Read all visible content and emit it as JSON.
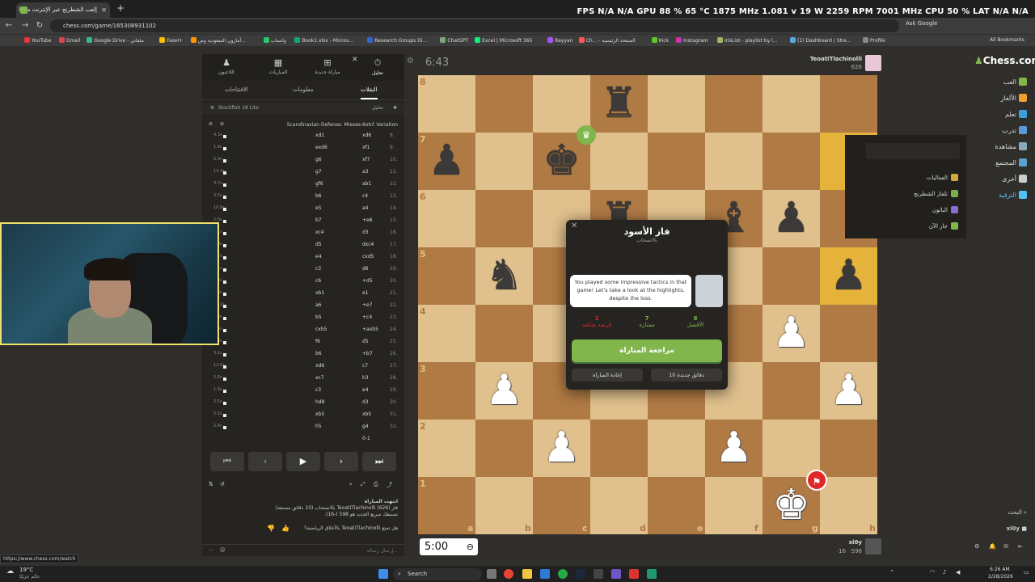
{
  "browser": {
    "tab_title": "إلعب الشطرنج عبر الإنترنت مجانًا",
    "url": "chess.com/game/165308931102",
    "ask_google": "Ask Google",
    "all_bookmarks": "All Bookmarks",
    "bookmarks": [
      "YouTube",
      "Gmail",
      "Google Drive - ملفاتي",
      "Fasel+",
      "أمازون السعودية وص...",
      "واتساب",
      "Book1.xlsx - Micros...",
      "Research Groups Di...",
      "ChatGPT",
      "Excel | Microsoft 365",
      "Rayyan",
      "Ch... - الصفحة الرئيسية",
      "Kick",
      "Instagram",
      "IrisList - playlist by l...",
      "(1) Dashboard / Stre...",
      "Profile"
    ]
  },
  "hud": "FPS  N/A  N/A    GPU  88 %  65 °C  1875 MHz  1.081 v  19 W  2259 RPM  7001 MHz    CPU  50 %    LAT  N/A  N/A",
  "panel": {
    "tabs": [
      "تحليل",
      "مباراة جديدة",
      "المباريات",
      "اللاعبون"
    ],
    "subtabs": [
      "النقلات",
      "معلومات",
      "الافتتاحات"
    ],
    "engine": "Stockfish 18 Lite",
    "analysis_label": "تحليل",
    "opening": "Scandinavian Defense: Mieses-Kotrč Variation",
    "moves": [
      {
        "n": "8.",
        "w": "xd6",
        "b": "xd1",
        "t": "4.3s"
      },
      {
        "n": "9.",
        "w": "xf1",
        "b": "exd6",
        "t": "1.8s"
      },
      {
        "n": "10.",
        "w": "xf7",
        "b": "g6",
        "t": "5.9s"
      },
      {
        "n": "11.",
        "w": "a3",
        "b": "g7",
        "t": "13.4s"
      },
      {
        "n": "12.",
        "w": "ab1",
        "b": "gf6",
        "t": "3.7s"
      },
      {
        "n": "13.",
        "w": "c4",
        "b": "b6",
        "t": "3.5s"
      },
      {
        "n": "14.",
        "w": "a4",
        "b": "e5",
        "t": "10.6s"
      },
      {
        "n": "15.",
        "w": "+e6",
        "b": "b7",
        "t": "2.0s"
      },
      {
        "n": "16.",
        "w": "d3",
        "b": "xc4",
        "t": "1.1s"
      },
      {
        "n": "17.",
        "w": "dxc4",
        "b": "d5",
        "t": "3.0s"
      },
      {
        "n": "18.",
        "w": "cxd5",
        "b": "e4",
        "t": "1.7s"
      },
      {
        "n": "19.",
        "w": "d6",
        "b": "c3",
        "t": "2.1s"
      },
      {
        "n": "20.",
        "w": "+d5",
        "b": "c6",
        "t": "7.6s"
      },
      {
        "n": "21.",
        "w": "e1",
        "b": "xb1",
        "t": "2.0s"
      },
      {
        "n": "22.",
        "w": "+e7",
        "b": "a6",
        "t": "11.2s"
      },
      {
        "n": "23.",
        "w": "+c4",
        "b": "b5",
        "t": "3.0s"
      },
      {
        "n": "24.",
        "w": "+axb5",
        "b": "cxb5",
        "t": "2.6s"
      },
      {
        "n": "25.",
        "w": "d5",
        "b": "f6",
        "t": "6.0s"
      },
      {
        "n": "26.",
        "w": "+b7",
        "b": "b6",
        "t": "3.2s"
      },
      {
        "n": "27.",
        "w": "c7",
        "b": "xd6",
        "t": "12.5s"
      },
      {
        "n": "28.",
        "w": "h3",
        "b": "xc7",
        "t": "5.6s"
      },
      {
        "n": "29.",
        "w": "e4",
        "b": "c3",
        "t": "1.0s"
      },
      {
        "n": "30.",
        "w": "d3",
        "b": "hd8",
        "t": "2.5s"
      },
      {
        "n": "31.",
        "w": "xb5",
        "b": "xb5",
        "t": "5.5s"
      },
      {
        "n": "32.",
        "w": "g4",
        "b": "h5",
        "t": "2.4s"
      },
      {
        "n": "",
        "w": "0-1",
        "b": "",
        "t": ""
      }
    ],
    "controls": [
      "⏮",
      "‹",
      "▶",
      "›",
      "⏭"
    ],
    "chat": [
      "انتهت المباراة",
      "فاز TeoatiTlachinolli (626) بالانسحاب (10 دقائق مصنفة)",
      "تصنيفك سريع الجديد هو 598 (-16).",
      "هل تمتع TeoatiTlachinolli بالأخلاق الرياضية؟"
    ],
    "chat_placeholder": "إرسال رسالة..."
  },
  "game": {
    "top_timer": "6:43",
    "top_player": "TeoatiTlachinolli",
    "top_rating": "626",
    "bottom_clock": "5:00",
    "bottom_player": "xi0y",
    "bottom_rating": "598",
    "bottom_delta": "-16"
  },
  "board": {
    "files": [
      "a",
      "b",
      "c",
      "d",
      "e",
      "f",
      "g",
      "h"
    ],
    "ranks": [
      "8",
      "7",
      "6",
      "5",
      "4",
      "3",
      "2",
      "1"
    ],
    "pieces": [
      {
        "sq": "d8",
        "p": "♜",
        "c": "b"
      },
      {
        "sq": "a7",
        "p": "♟",
        "c": "b"
      },
      {
        "sq": "c7",
        "p": "♚",
        "c": "b"
      },
      {
        "sq": "d6",
        "p": "♜",
        "c": "b"
      },
      {
        "sq": "f6",
        "p": "♝",
        "c": "b"
      },
      {
        "sq": "g6",
        "p": "♟",
        "c": "b"
      },
      {
        "sq": "b5",
        "p": "♞",
        "c": "b"
      },
      {
        "sq": "h5",
        "p": "♟",
        "c": "b"
      },
      {
        "sq": "g4",
        "p": "♟",
        "c": "w"
      },
      {
        "sq": "b3",
        "p": "♟",
        "c": "w"
      },
      {
        "sq": "h3",
        "p": "♟",
        "c": "w"
      },
      {
        "sq": "c2",
        "p": "♟",
        "c": "w"
      },
      {
        "sq": "f2",
        "p": "♟",
        "c": "w"
      },
      {
        "sq": "g1",
        "p": "♚",
        "c": "w"
      }
    ],
    "highlights": [
      "h7",
      "h5"
    ]
  },
  "modal": {
    "title": "فاز الأسود",
    "subtitle": "بالانسحاب",
    "message": "You played some impressive tactics in that game! Let's take a look at the highlights, despite the loss.",
    "stats": [
      {
        "n": "6",
        "label": "الأفضل",
        "color": "#81b64c"
      },
      {
        "n": "7",
        "label": "ممتازة",
        "color": "#81b64c"
      },
      {
        "n": "1",
        "label": "فرصة ضائعة",
        "color": "#e02828"
      }
    ],
    "review": "مراجعة المباراة",
    "new_game": "10 دقائق جديدة",
    "rematch": "إعادة المباراة"
  },
  "nav": {
    "logo": "Chess",
    "logo_suffix": ".com",
    "items": [
      "العب",
      "الألغاز",
      "تعلم",
      "تدرب",
      "مشاهدة",
      "المجتمع",
      "أخرى",
      "الترقية"
    ],
    "flyout": [
      "الفعاليات",
      "تلفاز الشطرنج",
      "الباثون",
      "جار الآن"
    ],
    "search": "البحث",
    "user": "xi0y"
  },
  "status_url": "https://www.chess.com/watch",
  "taskbar": {
    "weather": "19°C",
    "weather_sub": "عالم جزئيًا",
    "search": "Search",
    "time": "6:26 AM",
    "date": "2/28/2026"
  },
  "colors": {
    "accent": "#81b64c",
    "board_light": "#e0c08c",
    "board_dark": "#b07a45",
    "highlight": "#e5b23a"
  }
}
